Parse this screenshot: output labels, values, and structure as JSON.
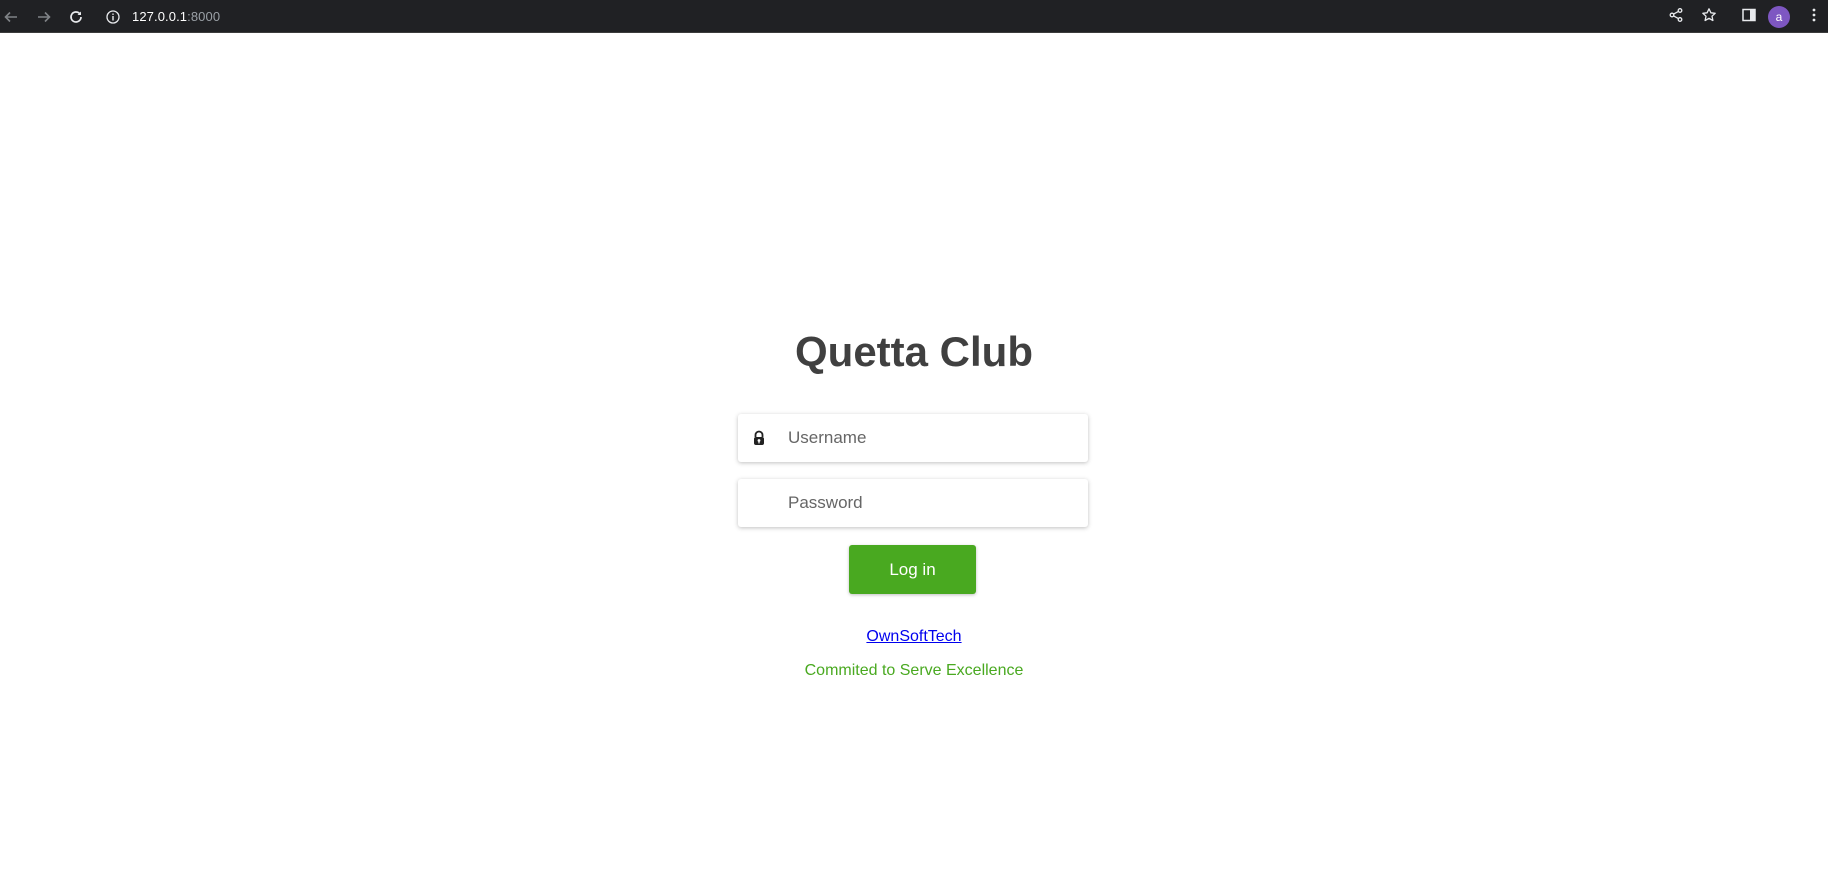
{
  "browser": {
    "url_host": "127.0.0.1",
    "url_port": ":8000",
    "avatar_letter": "a",
    "icons": {
      "back": "arrow-left-icon",
      "forward": "arrow-right-icon",
      "reload": "reload-icon",
      "site_info": "info-icon",
      "share": "share-icon",
      "bookmark": "star-icon",
      "side_panel": "side-panel-icon",
      "menu": "kebab-menu-icon"
    },
    "colors": {
      "bar": "#202124",
      "avatar": "#7e57c2"
    }
  },
  "login": {
    "title": "Quetta Club",
    "username_placeholder": "Username",
    "password_placeholder": "Password",
    "username_icon": "lock-icon",
    "submit_label": "Log in",
    "brand_link": "OwnSoftTech",
    "tagline": "Commited to Serve Excellence",
    "colors": {
      "accent": "#49a920",
      "title": "#404040",
      "link": "#0000ee"
    }
  }
}
